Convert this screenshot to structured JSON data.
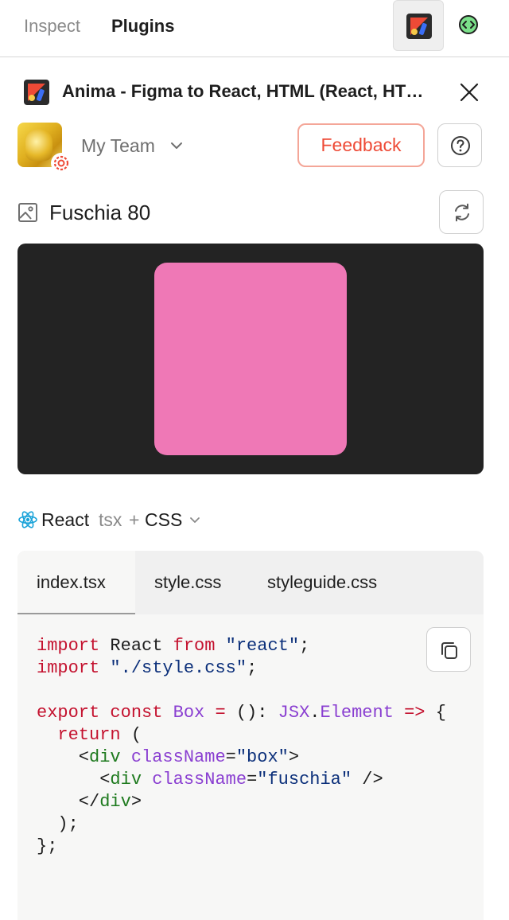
{
  "topbar": {
    "tabs": [
      "Inspect",
      "Plugins"
    ],
    "active_tab": "Plugins"
  },
  "plugin": {
    "title": "Anima - Figma to React, HTML (React, HTML, CSS)"
  },
  "team": {
    "name": "My Team"
  },
  "buttons": {
    "feedback": "Feedback"
  },
  "frame": {
    "name": "Fuschia 80",
    "preview_color": "#EF78B6",
    "preview_bg": "#232323"
  },
  "framework": {
    "name": "React",
    "variant": "tsx",
    "plus": "+",
    "styling": "CSS"
  },
  "code_tabs": [
    "index.tsx",
    "style.css",
    "styleguide.css"
  ],
  "active_code_tab": "index.tsx",
  "code": {
    "line1": [
      "import",
      " React ",
      "from",
      " ",
      "\"react\"",
      ";"
    ],
    "line2": [
      "import",
      " ",
      "\"./style.css\"",
      ";"
    ],
    "line4": [
      "export",
      " ",
      "const",
      " ",
      "Box",
      " ",
      "=",
      " (): ",
      "JSX",
      ".",
      "Element",
      " ",
      "=>",
      " {"
    ],
    "line5": [
      "  ",
      "return",
      " ("
    ],
    "line6": [
      "    <",
      "div",
      " ",
      "className",
      "=",
      "\"box\"",
      ">"
    ],
    "line7": [
      "      <",
      "div",
      " ",
      "className",
      "=",
      "\"fuschia\"",
      " />"
    ],
    "line8": [
      "    </",
      "div",
      ">"
    ],
    "line9": [
      "  );"
    ],
    "line10": [
      "};"
    ]
  },
  "colors": {
    "accent_red": "#EE4A36",
    "keyword": "#C4122F",
    "string": "#0B2F7A",
    "type": "#8A3FD1",
    "tag": "#1E7A1E"
  },
  "icons": {
    "plugin_logo": "anima-logo-icon",
    "code": "code-brackets-icon",
    "close": "close-icon",
    "help": "question-circle-icon",
    "frame": "image-icon",
    "sync": "sync-icon",
    "copy": "copy-icon",
    "react": "react-icon",
    "settings": "gear-icon"
  }
}
